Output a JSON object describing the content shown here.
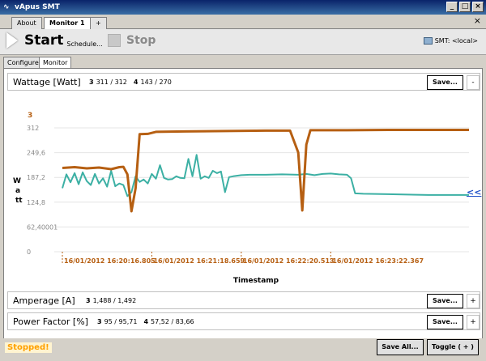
{
  "app": {
    "title": "vApus SMT"
  },
  "window_buttons": [
    "_",
    "□",
    "×"
  ],
  "doc_tabs": [
    {
      "label": "About"
    },
    {
      "label": "Monitor 1"
    },
    {
      "label": "+"
    }
  ],
  "tab_close": "×",
  "toolbar": {
    "start_label": "Start",
    "schedule_label": "Schedule...",
    "stop_label": "Stop",
    "smt_label": "SMT: <local>"
  },
  "sub_tabs": [
    {
      "label": "Configure"
    },
    {
      "label": "Monitor"
    }
  ],
  "wattage": {
    "title": "Wattage [Watt]",
    "readings": [
      {
        "id": "3",
        "value": "311 / 312"
      },
      {
        "id": "4",
        "value": "143 / 270"
      }
    ],
    "save_label": "Save...",
    "toggle_label": "-"
  },
  "amperage": {
    "title": "Amperage [A]",
    "readings": [
      {
        "id": "3",
        "value": "1,488 / 1,492"
      }
    ],
    "save_label": "Save...",
    "toggle_label": "+"
  },
  "power_factor": {
    "title": "Power Factor [%]",
    "readings": [
      {
        "id": "3",
        "value": "95 / 95,71"
      },
      {
        "id": "4",
        "value": "57,52 / 83,66"
      }
    ],
    "save_label": "Save...",
    "toggle_label": "+"
  },
  "collapse_link": "<<",
  "status_text": "Stopped!",
  "save_all_label": "Save All...",
  "toggle_all_label": "Toggle ( + )",
  "colors": {
    "series_3": "#b65f12",
    "series_4": "#3cb0a4",
    "status": "#ffa000"
  },
  "chart_data": {
    "type": "line",
    "legend": [
      "3"
    ],
    "xlabel": "Timestamp",
    "ylabel": "Watt",
    "yticks": [
      "312",
      "249,6",
      "187,2",
      "124,8",
      "62,40001",
      "0"
    ],
    "ylim": [
      0,
      312
    ],
    "xticks": [
      "16/01/2012 16:20:16.805",
      "16/01/2012 16:21:18.659",
      "16/01/2012 16:22:20.513",
      "16/01/2012 16:23:22.367"
    ],
    "xlim": [
      0,
      100
    ],
    "grid": true,
    "series": [
      {
        "name": "3",
        "points": [
          [
            0,
            211
          ],
          [
            3,
            213
          ],
          [
            6,
            210
          ],
          [
            9,
            212
          ],
          [
            12,
            208
          ],
          [
            14,
            213
          ],
          [
            15,
            214
          ],
          [
            16,
            195
          ],
          [
            17,
            102
          ],
          [
            18,
            160
          ],
          [
            19,
            296
          ],
          [
            21,
            297
          ],
          [
            23,
            302
          ],
          [
            30,
            303
          ],
          [
            40,
            304
          ],
          [
            50,
            305
          ],
          [
            56,
            305
          ],
          [
            58,
            250
          ],
          [
            59,
            104
          ],
          [
            60,
            270
          ],
          [
            61,
            306
          ],
          [
            70,
            306
          ],
          [
            80,
            307
          ],
          [
            90,
            307
          ],
          [
            100,
            307
          ]
        ]
      },
      {
        "name": "4",
        "points": [
          [
            0,
            160
          ],
          [
            1,
            195
          ],
          [
            2,
            175
          ],
          [
            3,
            198
          ],
          [
            4,
            170
          ],
          [
            5,
            200
          ],
          [
            6,
            178
          ],
          [
            7,
            168
          ],
          [
            8,
            196
          ],
          [
            9,
            172
          ],
          [
            10,
            185
          ],
          [
            11,
            164
          ],
          [
            12,
            204
          ],
          [
            13,
            165
          ],
          [
            14,
            172
          ],
          [
            15,
            168
          ],
          [
            16,
            140
          ],
          [
            17,
            150
          ],
          [
            18,
            190
          ],
          [
            19,
            176
          ],
          [
            20,
            182
          ],
          [
            21,
            172
          ],
          [
            22,
            196
          ],
          [
            23,
            184
          ],
          [
            24,
            218
          ],
          [
            25,
            186
          ],
          [
            26,
            182
          ],
          [
            27,
            183
          ],
          [
            28,
            190
          ],
          [
            29,
            186
          ],
          [
            30,
            185
          ],
          [
            31,
            234
          ],
          [
            32,
            190
          ],
          [
            33,
            244
          ],
          [
            34,
            184
          ],
          [
            35,
            190
          ],
          [
            36,
            186
          ],
          [
            37,
            204
          ],
          [
            38,
            198
          ],
          [
            39,
            202
          ],
          [
            40,
            150
          ],
          [
            41,
            188
          ],
          [
            42,
            190
          ],
          [
            44,
            193
          ],
          [
            46,
            194
          ],
          [
            50,
            194
          ],
          [
            54,
            195
          ],
          [
            58,
            194
          ],
          [
            60,
            196
          ],
          [
            62,
            193
          ],
          [
            64,
            196
          ],
          [
            66,
            197
          ],
          [
            68,
            195
          ],
          [
            70,
            194
          ],
          [
            71,
            185
          ],
          [
            72,
            147
          ],
          [
            74,
            146
          ],
          [
            80,
            145
          ],
          [
            90,
            143
          ],
          [
            100,
            143
          ]
        ]
      }
    ]
  }
}
